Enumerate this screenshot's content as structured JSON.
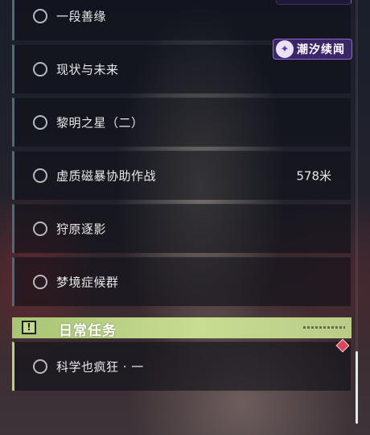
{
  "quests": [
    {
      "label": "一段善缘",
      "distance": ""
    },
    {
      "label": "现状与未来",
      "distance": ""
    },
    {
      "label": "黎明之星（二）",
      "distance": ""
    },
    {
      "label": "虚质磁暴协助作战",
      "distance": "578米"
    },
    {
      "label": "狩原逐影",
      "distance": ""
    },
    {
      "label": "梦境症候群",
      "distance": ""
    }
  ],
  "badge": {
    "text": "潮汐续闻",
    "icon": "tide-icon"
  },
  "daily_section": {
    "title": "日常任务",
    "icon": "exclamation-icon",
    "accent": "#c8dc92"
  },
  "daily_quests": [
    {
      "label": "科学也疯狂 · 一"
    }
  ],
  "colors": {
    "row_accent": "#4f6a73",
    "daily_accent": "#b7d07a",
    "badge_bg": "#3b2667",
    "marker": "#d84a5a"
  }
}
